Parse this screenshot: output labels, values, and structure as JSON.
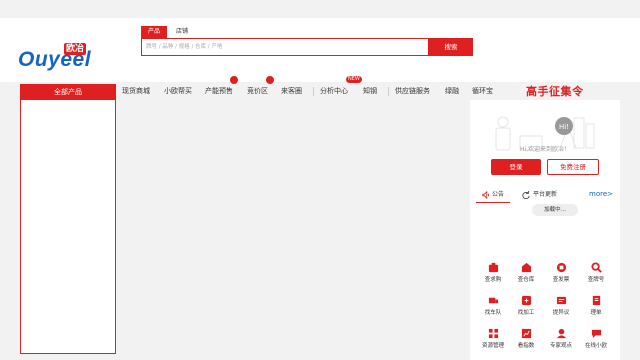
{
  "brand": {
    "logo_text": "Ouyeel",
    "logo_cn": "欧冶"
  },
  "search": {
    "tabs": [
      "产品",
      "店铺"
    ],
    "placeholder": "牌号 / 品种 / 规格 / 仓库 / 产地",
    "button_label": "搜索"
  },
  "nav": {
    "all_products": "全部产品",
    "items": [
      "现货商城",
      "小欧帮买",
      "产能预售",
      "竞价区",
      "来客圈",
      "分析中心",
      "知钢",
      "供应链服务",
      "绿融",
      "循环宝"
    ],
    "new_badge": "NEW",
    "slogan": "高手征集令"
  },
  "user_panel": {
    "welcome": "Hi,欢迎来到欧冶！",
    "login_label": "登录",
    "register_label": "免费注册",
    "tabs": [
      "公告",
      "平台更新"
    ],
    "more_label": "more>",
    "loading_label": "加载中..."
  },
  "quick_links": [
    "查求购",
    "查仓库",
    "查发票",
    "查牌号",
    "找车队",
    "找加工",
    "提异议",
    "理单",
    "资源管理",
    "看指数",
    "专家观点",
    "在线小欧"
  ],
  "colors": {
    "accent": "#e02020",
    "link": "#1565c0"
  }
}
